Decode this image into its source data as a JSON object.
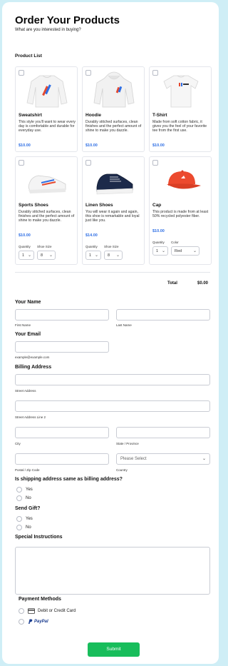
{
  "header": {
    "title": "Order Your Products",
    "subtitle": "What are you interested in buying?"
  },
  "product_list_label": "Product List",
  "products": [
    {
      "name": "Sweatshirt",
      "description": "This style you'll want to wear every day is comfortable and durable for everyday use.",
      "price": "$10.00",
      "image": "sweatshirt-image"
    },
    {
      "name": "Hoodie",
      "description": "Durably stitched surfaces, clean finishes and the perfect amount of shine to make you dazzle.",
      "price": "$10.00",
      "image": "hoodie-image"
    },
    {
      "name": "T-Shirt",
      "description": "Made from soft cotton fabric, it gives you the feel of your favorite tee from the first use.",
      "price": "$10.00",
      "image": "tshirt-image"
    },
    {
      "name": "Sports Shoes",
      "description": "Durably stitched surfaces, clean finishes and the perfect amount of shine to make you dazzle.",
      "price": "$10.00",
      "image": "sports-shoes-image",
      "options": [
        {
          "label": "Quantity",
          "value": "1"
        },
        {
          "label": "Shoe Size",
          "value": "8"
        }
      ]
    },
    {
      "name": "Linen Shoes",
      "description": "You will wear it again and again, this shoe is remarkable and loyal just like you.",
      "price": "$14.00",
      "image": "linen-shoes-image",
      "options": [
        {
          "label": "Quantity",
          "value": "1"
        },
        {
          "label": "Shoe Size",
          "value": "8"
        }
      ]
    },
    {
      "name": "Cap",
      "description": "This product is made from at least 50% recycled polyester fiber.",
      "price": "$10.00",
      "image": "cap-image",
      "options": [
        {
          "label": "Quantity",
          "value": "1"
        },
        {
          "label": "Color",
          "value": "Red"
        }
      ]
    }
  ],
  "total": {
    "label": "Total",
    "value": "$0.00"
  },
  "form": {
    "name_label": "Your Name",
    "first_name": "First Name",
    "last_name": "Last Name",
    "email_label": "Your Email",
    "email_hint": "example@example.com",
    "billing_label": "Billing Address",
    "street": "Street Address",
    "street2": "Street Address Line 2",
    "city": "City",
    "state": "State / Province",
    "postal": "Postal / Zip Code",
    "country": "Country",
    "country_placeholder": "Please Select",
    "shipping_q": "Is shipping address same as billing address?",
    "yes": "Yes",
    "no": "No",
    "gift_q": "Send Gift?",
    "special_label": "Special Instructions",
    "payment_label": "Payment Methods",
    "payment_card": "Debit or Credit Card",
    "payment_paypal": "PayPal",
    "submit": "Submit"
  },
  "colors": {
    "accent": "#18bd5b",
    "price": "#2f6fe4",
    "background": "#cfeef6"
  }
}
